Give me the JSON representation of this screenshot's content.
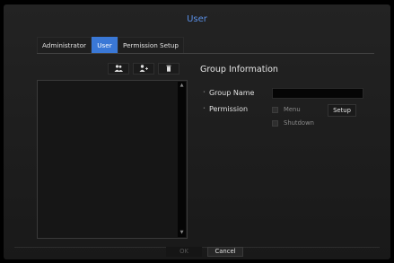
{
  "window": {
    "title": "User"
  },
  "tabs": [
    {
      "label": "Administrator",
      "active": false
    },
    {
      "label": "User",
      "active": true
    },
    {
      "label": "Permission Setup",
      "active": false
    }
  ],
  "toolbar": {
    "buttons": [
      {
        "icon": "users-group-icon",
        "glyph": "👥"
      },
      {
        "icon": "user-add-icon",
        "glyph": "👤+"
      },
      {
        "icon": "trash-icon",
        "glyph": "🗑"
      }
    ]
  },
  "group_list": {
    "items": []
  },
  "group_info": {
    "heading": "Group Information",
    "group_name_label": "Group Name",
    "group_name_value": "",
    "permission_label": "Permission",
    "permissions": [
      {
        "label": "Menu",
        "checked": false
      },
      {
        "label": "Shutdown",
        "checked": false
      }
    ],
    "setup_label": "Setup"
  },
  "footer": {
    "ok_label": "OK",
    "cancel_label": "Cancel"
  },
  "colors": {
    "accent": "#3a78d6",
    "title": "#5a8fe6",
    "background": "#1c1c1c"
  }
}
